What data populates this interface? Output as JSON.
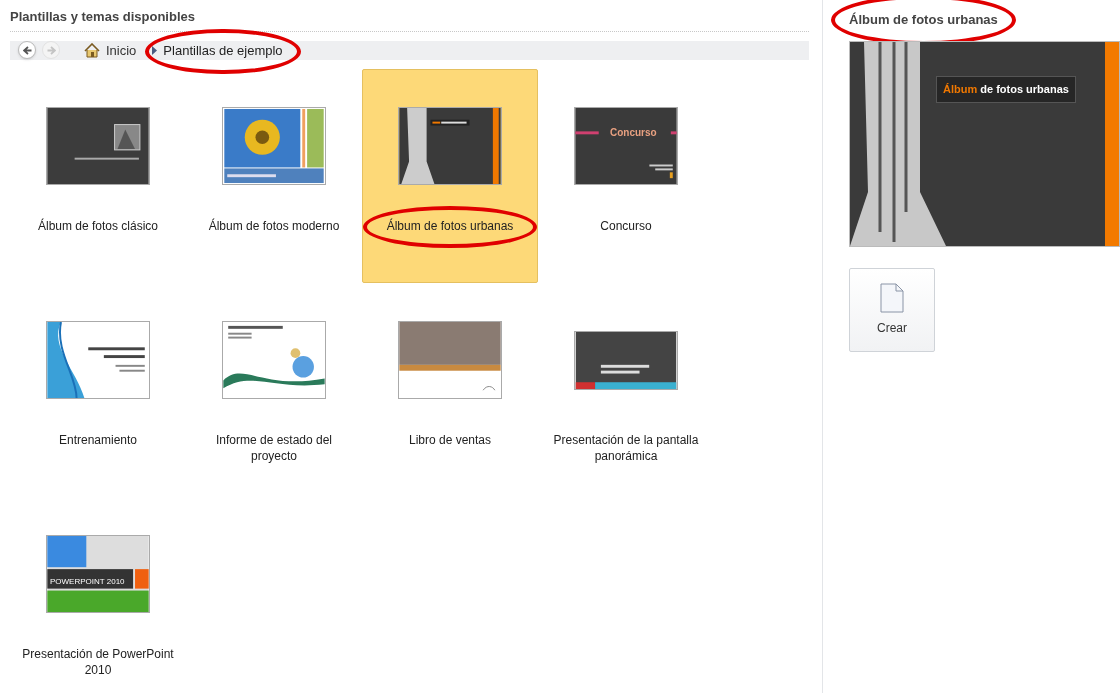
{
  "header": {
    "title": "Plantillas y temas disponibles"
  },
  "breadcrumb": {
    "back_disabled": false,
    "forward_disabled": true,
    "items": [
      {
        "label": "Inicio",
        "kind": "home",
        "circled": false
      },
      {
        "label": "Plantillas de ejemplo",
        "kind": "current",
        "circled": true
      }
    ]
  },
  "templates": [
    {
      "label": "Álbum de fotos clásico",
      "selected": false,
      "circled": false,
      "kind": "classic"
    },
    {
      "label": "Álbum de fotos moderno",
      "selected": false,
      "circled": false,
      "kind": "modern"
    },
    {
      "label": "Álbum de fotos urbanas",
      "selected": true,
      "circled": true,
      "kind": "urban"
    },
    {
      "label": "Concurso",
      "selected": false,
      "circled": false,
      "kind": "contest",
      "slide_title": "Concurso"
    },
    {
      "label": "Entrenamiento",
      "selected": false,
      "circled": false,
      "kind": "wave"
    },
    {
      "label": "Informe de estado del proyecto",
      "selected": false,
      "circled": false,
      "kind": "report"
    },
    {
      "label": "Libro de ventas",
      "selected": false,
      "circled": false,
      "kind": "sales"
    },
    {
      "label": "Presentación de la pantalla panorámica",
      "selected": false,
      "circled": false,
      "kind": "wide"
    },
    {
      "label": "Presentación de PowerPoint 2010",
      "selected": false,
      "circled": false,
      "kind": "powerpoint",
      "slide_title": "POWERPOINT 2010"
    }
  ],
  "preview": {
    "title": "Álbum de fotos urbanas",
    "circled": true,
    "slide_accent": "Álbum",
    "slide_rest": "de fotos urbanas"
  },
  "create_button": {
    "label": "Crear"
  }
}
